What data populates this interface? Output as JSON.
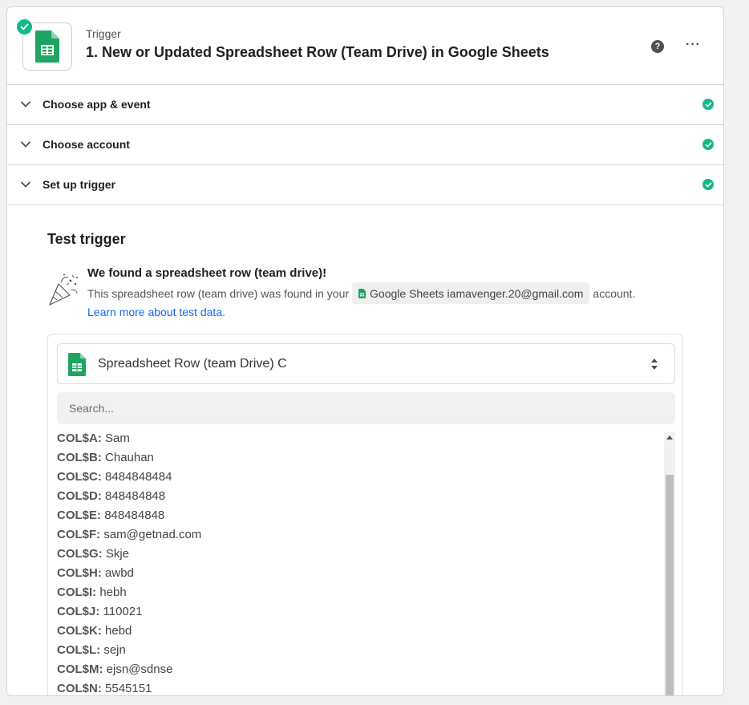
{
  "header": {
    "eyebrow": "Trigger",
    "title": "1. New or Updated Spreadsheet Row (Team Drive) in Google Sheets",
    "help_icon": "question-circle-icon",
    "more_icon": "ellipsis-icon"
  },
  "sections": [
    {
      "label": "Choose app & event",
      "status": "complete"
    },
    {
      "label": "Choose account",
      "status": "complete"
    },
    {
      "label": "Set up trigger",
      "status": "complete"
    }
  ],
  "test": {
    "title": "Test trigger",
    "found_title": "We found a spreadsheet row (team drive)!",
    "found_prefix": "This spreadsheet row (team drive) was found in your",
    "chip_label": "Google Sheets iamavenger.20@gmail.com",
    "found_suffix": "account.",
    "learn_link": "Learn more about test data."
  },
  "select": {
    "value": "Spreadsheet Row (team Drive) C"
  },
  "search": {
    "placeholder": "Search..."
  },
  "fields": [
    {
      "key": "COL$A:",
      "value": "Sam"
    },
    {
      "key": "COL$B:",
      "value": "Chauhan"
    },
    {
      "key": "COL$C:",
      "value": "8484848484"
    },
    {
      "key": "COL$D:",
      "value": "848484848"
    },
    {
      "key": "COL$E:",
      "value": "848484848"
    },
    {
      "key": "COL$F:",
      "value": "sam@getnad.com"
    },
    {
      "key": "COL$G:",
      "value": "Skje"
    },
    {
      "key": "COL$H:",
      "value": "awbd"
    },
    {
      "key": "COL$I:",
      "value": "hebh"
    },
    {
      "key": "COL$J:",
      "value": "110021"
    },
    {
      "key": "COL$K:",
      "value": "hebd"
    },
    {
      "key": "COL$L:",
      "value": "sejn"
    },
    {
      "key": "COL$M:",
      "value": "ejsn@sdnse"
    },
    {
      "key": "COL$N:",
      "value": "5545151"
    }
  ],
  "colors": {
    "success": "#13b88a",
    "sheets_green": "#1fa463",
    "link": "#136bf5"
  }
}
